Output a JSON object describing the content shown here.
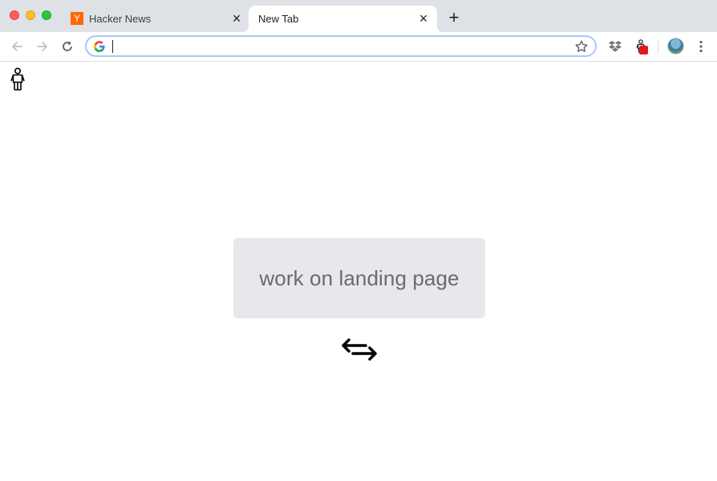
{
  "window": {
    "tabs": [
      {
        "title": "Hacker News",
        "favicon_letter": "Y",
        "favicon_color": "#ff6600",
        "active": false
      },
      {
        "title": "New Tab",
        "active": true
      }
    ]
  },
  "toolbar": {
    "omnibox": {
      "value": "",
      "placeholder": ""
    },
    "icons": [
      "back-arrow-icon",
      "forward-arrow-icon",
      "reload-icon",
      "google-g-icon",
      "bookmark-star-icon",
      "dropbox-icon",
      "person-extension-icon",
      "avatar",
      "more-menu-icon"
    ]
  },
  "content": {
    "task_label": "work on landing page",
    "card_color": "#e8e8ec",
    "icons": [
      "person-icon",
      "swap-arrows-icon"
    ]
  }
}
